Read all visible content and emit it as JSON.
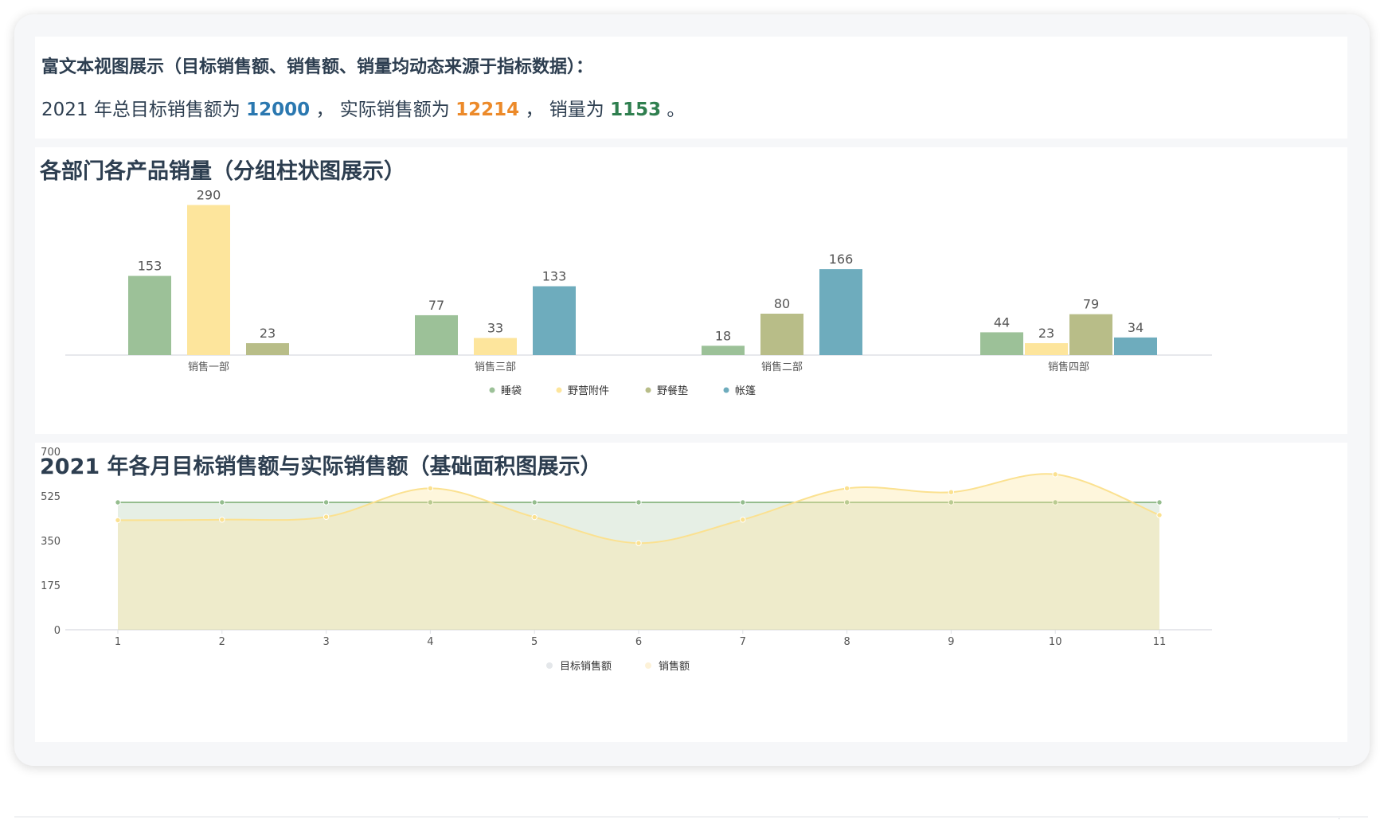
{
  "rich_text": {
    "title": "富文本视图展示（目标销售额、销售额、销量均动态来源于指标数据）：",
    "prefix": "2021 年总目标销售额为 ",
    "target_total": "12000",
    "sep1": " ， 实际销售额为 ",
    "actual_total": "12214",
    "sep2": " ， 销量为 ",
    "volume_total": "1153",
    "suffix": " 。",
    "colors": {
      "target": "#2b78b0",
      "actual": "#ec8a2a",
      "volume": "#2f7f4f"
    }
  },
  "corner_mark": "·",
  "chart_data": [
    {
      "type": "bar",
      "title": "各部门各产品销量（分组柱状图展示）",
      "categories": [
        "销售一部",
        "销售三部",
        "销售二部",
        "销售四部"
      ],
      "series": [
        {
          "name": "睡袋",
          "color": "#9cc198",
          "values": [
            153,
            77,
            18,
            44
          ]
        },
        {
          "name": "野营附件",
          "color": "#fde59c",
          "values": [
            290,
            33,
            null,
            23
          ]
        },
        {
          "name": "野餐垫",
          "color": "#b8bd88",
          "values": [
            23,
            null,
            80,
            79
          ]
        },
        {
          "name": "帐篷",
          "color": "#6eacbd",
          "values": [
            null,
            133,
            166,
            34
          ]
        }
      ],
      "ylim": [
        0,
        300
      ],
      "grid": false,
      "legend": "bottom-center",
      "data_labels": true
    },
    {
      "type": "area",
      "title": "2021 年各月目标销售额与实际销售额（基础面积图展示）",
      "x": [
        1,
        2,
        3,
        4,
        5,
        6,
        7,
        8,
        9,
        10,
        11
      ],
      "series": [
        {
          "name": "目标销售额",
          "color": "#9cc198",
          "values": [
            500,
            500,
            500,
            500,
            500,
            500,
            500,
            500,
            500,
            500,
            500
          ]
        },
        {
          "name": "销售额",
          "color": "#fde59c",
          "values": [
            430,
            432,
            443,
            555,
            442,
            340,
            432,
            555,
            540,
            610,
            450
          ]
        }
      ],
      "yticks": [
        0,
        175,
        350,
        525,
        700
      ],
      "ylim": [
        0,
        700
      ],
      "grid": false,
      "legend": "bottom-center"
    }
  ]
}
